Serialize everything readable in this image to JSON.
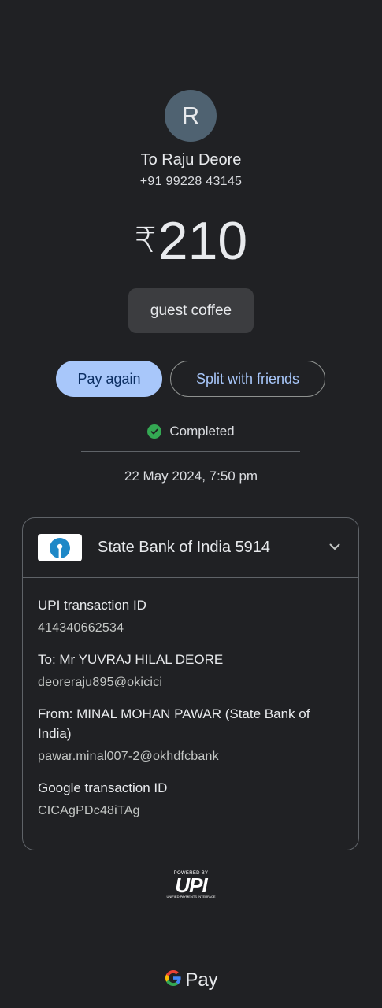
{
  "payee": {
    "avatar_letter": "R",
    "name": "To Raju Deore",
    "phone": "+91 99228 43145"
  },
  "payment": {
    "currency_symbol": "₹",
    "amount": "210",
    "note": "guest coffee"
  },
  "actions": {
    "pay_again": "Pay again",
    "split": "Split with friends"
  },
  "status": {
    "text": "Completed",
    "color": "#34a853",
    "datetime": "22 May 2024, 7:50 pm"
  },
  "bank": {
    "name": "State Bank of India 5914",
    "logo_icon": "sbi-logo-icon",
    "expand_icon": "chevron-down-icon"
  },
  "details": [
    {
      "label": "UPI transaction ID",
      "value": "414340662534"
    },
    {
      "label": "To: Mr YUVRAJ HILAL DEORE",
      "value": "deoreraju895@okicici"
    },
    {
      "label": "From: MINAL MOHAN PAWAR (State Bank of India)",
      "value": "pawar.minal007-2@okhdfcbank"
    },
    {
      "label": "Google transaction ID",
      "value": "CICAgPDc48iTAg"
    }
  ],
  "footer": {
    "upi_powered": "POWERED BY",
    "upi_mark": "UPI",
    "upi_sub": "UNIFIED PAYMENTS INTERFACE",
    "gpay_text": "Pay"
  },
  "colors": {
    "background": "#202124",
    "primary_button": "#a8c7fa",
    "sbi_blue": "#1e88c7"
  }
}
